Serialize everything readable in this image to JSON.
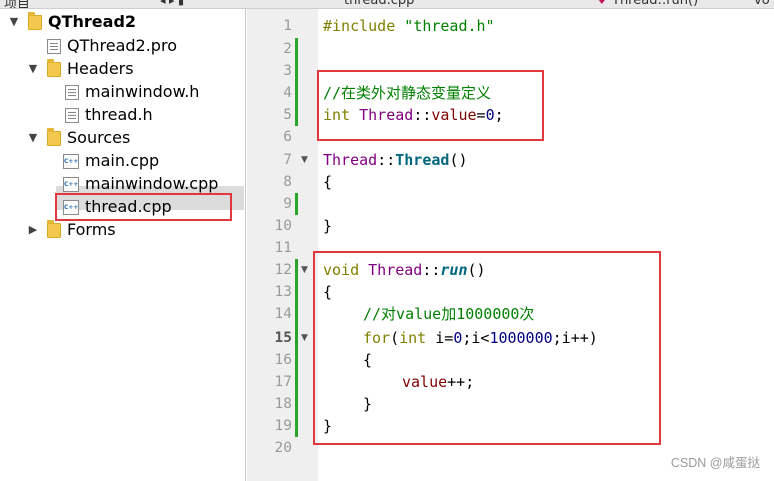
{
  "topbar": {
    "left_text": "项目",
    "tab_title": "thread.cpp",
    "function_crumb": "Thread::run()",
    "right_text": "vo"
  },
  "tree": {
    "project": {
      "label": "QThread2",
      "expanded": true
    },
    "pro_file": {
      "label": "QThread2.pro"
    },
    "headers": {
      "label": "Headers",
      "items": [
        {
          "label": "mainwindow.h"
        },
        {
          "label": "thread.h"
        }
      ]
    },
    "sources": {
      "label": "Sources",
      "items": [
        {
          "label": "main.cpp"
        },
        {
          "label": "mainwindow.cpp"
        },
        {
          "label": "thread.cpp",
          "selected": true
        }
      ]
    },
    "forms": {
      "label": "Forms",
      "expanded": false
    }
  },
  "editor": {
    "current_line": 15,
    "line_numbers": [
      "1",
      "2",
      "3",
      "4",
      "5",
      "6",
      "7",
      "8",
      "9",
      "10",
      "11",
      "12",
      "13",
      "14",
      "15",
      "16",
      "17",
      "18",
      "19",
      "20"
    ],
    "lines": {
      "l1_include": "#include",
      "l1_header": "\"thread.h\"",
      "l4_comment": "//在类外对静态变量定义",
      "l5_type": "int",
      "l5_class": "Thread",
      "l5_sep": "::",
      "l5_member": "value",
      "l5_assign": "=",
      "l5_zero": "0",
      "l5_semi": ";",
      "l7_class": "Thread",
      "l7_sep": "::",
      "l7_ctor": "Thread",
      "l7_parens": "()",
      "l8_brace": "{",
      "l10_brace": "}",
      "l12_void": "void",
      "l12_class": "Thread",
      "l12_sep": "::",
      "l12_run": "run",
      "l12_parens": "()",
      "l13_brace": "{",
      "l14_comment": "//对value加1000000次",
      "l15_for": "for",
      "l15_open": "(",
      "l15_int": "int",
      "l15_init": " i=",
      "l15_zero": "0",
      "l15_cond": ";i<",
      "l15_limit": "1000000",
      "l15_rest": ";i++)",
      "l16_brace": "{",
      "l17_value": "value",
      "l17_rest": "++;",
      "l18_brace": "}",
      "l19_brace": "}"
    }
  },
  "watermark": "CSDN @咸蛋挞"
}
